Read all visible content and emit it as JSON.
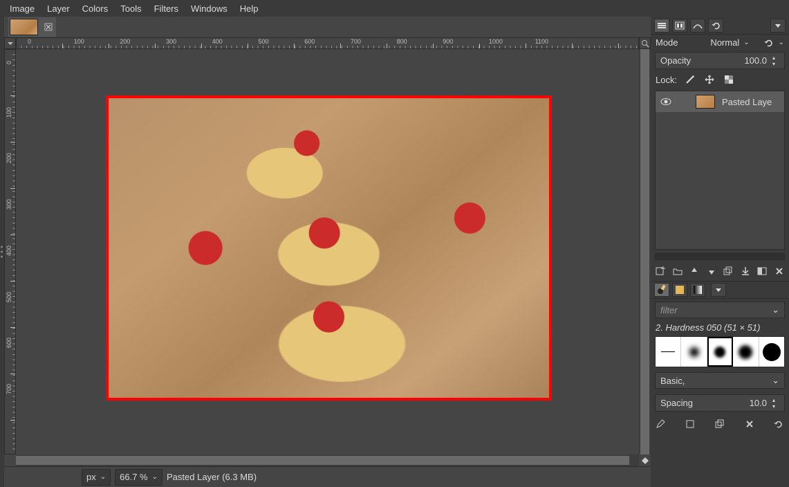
{
  "menubar": {
    "items": [
      "Image",
      "Layer",
      "Colors",
      "Tools",
      "Filters",
      "Windows",
      "Help"
    ]
  },
  "canvas": {
    "ruler_ticks_h": [
      0,
      100,
      200,
      300,
      400,
      500,
      600,
      700,
      800,
      900,
      1000,
      1100
    ],
    "ruler_ticks_v": [
      0,
      100,
      200,
      300,
      400,
      500,
      600,
      700
    ]
  },
  "statusbar": {
    "unit": "px",
    "zoom": "66.7 %",
    "layer_status": "Pasted Layer (6.3 MB)"
  },
  "layers": {
    "mode_label": "Mode",
    "mode_value": "Normal",
    "opacity_label": "Opacity",
    "opacity_value": "100.0",
    "lock_label": "Lock:",
    "items": [
      {
        "name": "Pasted Laye"
      }
    ]
  },
  "brushes": {
    "tab_labels": [
      "brushes-tab",
      "patterns-tab",
      "gradients-tab"
    ],
    "filter_placeholder": "filter",
    "selected_label": "2. Hardness 050 (51 × 51)",
    "preset_label": "Basic,",
    "spacing_label": "Spacing",
    "spacing_value": "10.0"
  },
  "icons": {
    "close": "×",
    "chevron_down": "⌄",
    "eye": "👁",
    "reset": "⟳"
  }
}
